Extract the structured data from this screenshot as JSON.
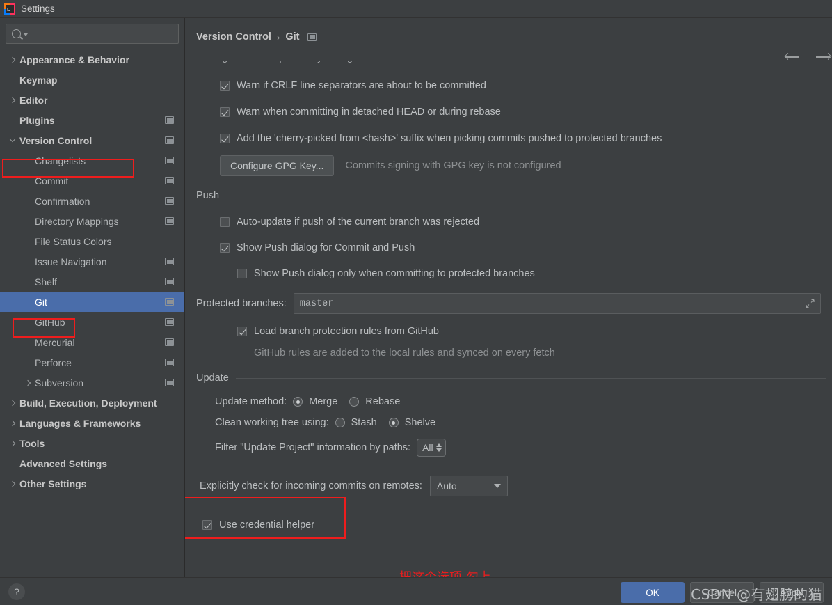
{
  "window": {
    "title": "Settings",
    "logo_icon": "intellij-idea-icon"
  },
  "sidebar": {
    "search": {
      "value": "",
      "placeholder": "",
      "icon": "search-icon"
    },
    "items": [
      {
        "label": "Appearance & Behavior",
        "level": 0,
        "bold": true,
        "twisty": "right",
        "mod": false,
        "selected": false
      },
      {
        "label": "Keymap",
        "level": 0,
        "bold": true,
        "twisty": "none",
        "mod": false,
        "selected": false
      },
      {
        "label": "Editor",
        "level": 0,
        "bold": true,
        "twisty": "right",
        "mod": false,
        "selected": false
      },
      {
        "label": "Plugins",
        "level": 0,
        "bold": true,
        "twisty": "none",
        "mod": true,
        "selected": false
      },
      {
        "label": "Version Control",
        "level": 0,
        "bold": true,
        "twisty": "down",
        "mod": true,
        "selected": false,
        "highlight": true
      },
      {
        "label": "Changelists",
        "level": 1,
        "bold": false,
        "twisty": "none",
        "mod": true,
        "selected": false
      },
      {
        "label": "Commit",
        "level": 1,
        "bold": false,
        "twisty": "none",
        "mod": true,
        "selected": false
      },
      {
        "label": "Confirmation",
        "level": 1,
        "bold": false,
        "twisty": "none",
        "mod": true,
        "selected": false
      },
      {
        "label": "Directory Mappings",
        "level": 1,
        "bold": false,
        "twisty": "none",
        "mod": true,
        "selected": false
      },
      {
        "label": "File Status Colors",
        "level": 1,
        "bold": false,
        "twisty": "none",
        "mod": false,
        "selected": false
      },
      {
        "label": "Issue Navigation",
        "level": 1,
        "bold": false,
        "twisty": "none",
        "mod": true,
        "selected": false
      },
      {
        "label": "Shelf",
        "level": 1,
        "bold": false,
        "twisty": "none",
        "mod": true,
        "selected": false
      },
      {
        "label": "Git",
        "level": 1,
        "bold": false,
        "twisty": "none",
        "mod": true,
        "selected": true,
        "highlight": true
      },
      {
        "label": "GitHub",
        "level": 1,
        "bold": false,
        "twisty": "none",
        "mod": true,
        "selected": false
      },
      {
        "label": "Mercurial",
        "level": 1,
        "bold": false,
        "twisty": "none",
        "mod": true,
        "selected": false
      },
      {
        "label": "Perforce",
        "level": 1,
        "bold": false,
        "twisty": "none",
        "mod": true,
        "selected": false
      },
      {
        "label": "Subversion",
        "level": 1,
        "bold": false,
        "twisty": "right",
        "mod": true,
        "selected": false
      },
      {
        "label": "Build, Execution, Deployment",
        "level": 0,
        "bold": true,
        "twisty": "right",
        "mod": false,
        "selected": false
      },
      {
        "label": "Languages & Frameworks",
        "level": 0,
        "bold": true,
        "twisty": "right",
        "mod": false,
        "selected": false
      },
      {
        "label": "Tools",
        "level": 0,
        "bold": true,
        "twisty": "right",
        "mod": false,
        "selected": false
      },
      {
        "label": "Advanced Settings",
        "level": 0,
        "bold": true,
        "twisty": "none",
        "mod": false,
        "selected": false
      },
      {
        "label": "Other Settings",
        "level": 0,
        "bold": true,
        "twisty": "right",
        "mod": false,
        "selected": false
      }
    ]
  },
  "breadcrumb": {
    "root": "Version Control",
    "separator": "›",
    "leaf": "Git",
    "project_icon": "project-scope-icon"
  },
  "nav": {
    "back_icon": "arrow-left-icon",
    "forward_icon": "arrow-right-icon"
  },
  "content": {
    "clipped_top_row": "ignore whitespace only changes",
    "commit_options": [
      {
        "label": "Warn if CRLF line separators are about to be committed",
        "checked": true
      },
      {
        "label": "Warn when committing in detached HEAD or during rebase",
        "checked": true
      },
      {
        "label": "Add the 'cherry-picked from <hash>' suffix when picking commits pushed to protected branches",
        "checked": true
      }
    ],
    "gpg": {
      "button_label": "Configure GPG Key...",
      "status": "Commits signing with GPG key is not configured"
    },
    "push": {
      "section_title": "Push",
      "options": [
        {
          "label": "Auto-update if push of the current branch was rejected",
          "checked": false,
          "indent": 0
        },
        {
          "label": "Show Push dialog for Commit and Push",
          "checked": true,
          "indent": 0
        },
        {
          "label": "Show Push dialog only when committing to protected branches",
          "checked": false,
          "indent": 1
        }
      ],
      "protected_branches_label": "Protected branches:",
      "protected_branches_value": "master",
      "expand_icon": "expand-diagonal-icon",
      "github_rules": {
        "label": "Load branch protection rules from GitHub",
        "checked": true
      },
      "github_hint": "GitHub rules are added to the local rules and synced on every fetch"
    },
    "update": {
      "section_title": "Update",
      "update_method_label": "Update method:",
      "update_method_options": [
        {
          "label": "Merge",
          "selected": true
        },
        {
          "label": "Rebase",
          "selected": false
        }
      ],
      "clean_tree_label": "Clean working tree using:",
      "clean_tree_options": [
        {
          "label": "Stash",
          "selected": false
        },
        {
          "label": "Shelve",
          "selected": true
        }
      ],
      "filter_label": "Filter \"Update Project\" information by paths:",
      "filter_value": "All"
    },
    "incoming": {
      "label": "Explicitly check for incoming commits on remotes:",
      "value": "Auto",
      "dropdown_icon": "chevron-down-icon"
    },
    "credential_helper": {
      "label": "Use credential helper",
      "checked": true
    }
  },
  "annotation": {
    "note_text": "把这个选项 勾上",
    "color": "#e81e1e"
  },
  "footer": {
    "help_label": "?",
    "ok_label": "OK",
    "cancel_label": "Cancel",
    "apply_label": "Apply"
  },
  "watermark": {
    "text": "CSDN @有翅膀的猫"
  }
}
